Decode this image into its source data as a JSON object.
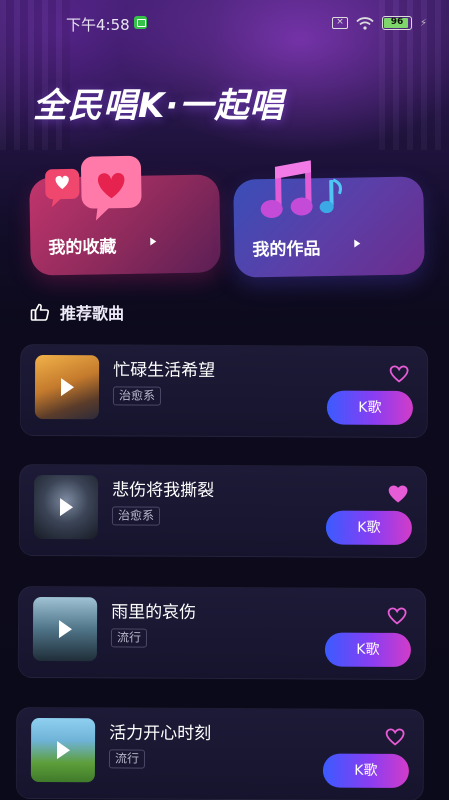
{
  "status_bar": {
    "time": "下午4:58",
    "battery": "96"
  },
  "header": {
    "title": "全民唱K·一起唱"
  },
  "cards": {
    "favorites_label": "我的收藏",
    "works_label": "我的作品"
  },
  "section": {
    "title": "推荐歌曲"
  },
  "songs": [
    {
      "title": "忙碌生活希望",
      "tag": "治愈系",
      "action": "K歌",
      "liked": false
    },
    {
      "title": "悲伤将我撕裂",
      "tag": "治愈系",
      "action": "K歌",
      "liked": true
    },
    {
      "title": "雨里的哀伤",
      "tag": "流行",
      "action": "K歌",
      "liked": false
    },
    {
      "title": "活力开心时刻",
      "tag": "流行",
      "action": "K歌",
      "liked": false
    }
  ],
  "colors": {
    "accent_start": "#3a5bff",
    "accent_end": "#d23cc8",
    "heart": "#e65bd6",
    "background": "#0c0a1c"
  }
}
